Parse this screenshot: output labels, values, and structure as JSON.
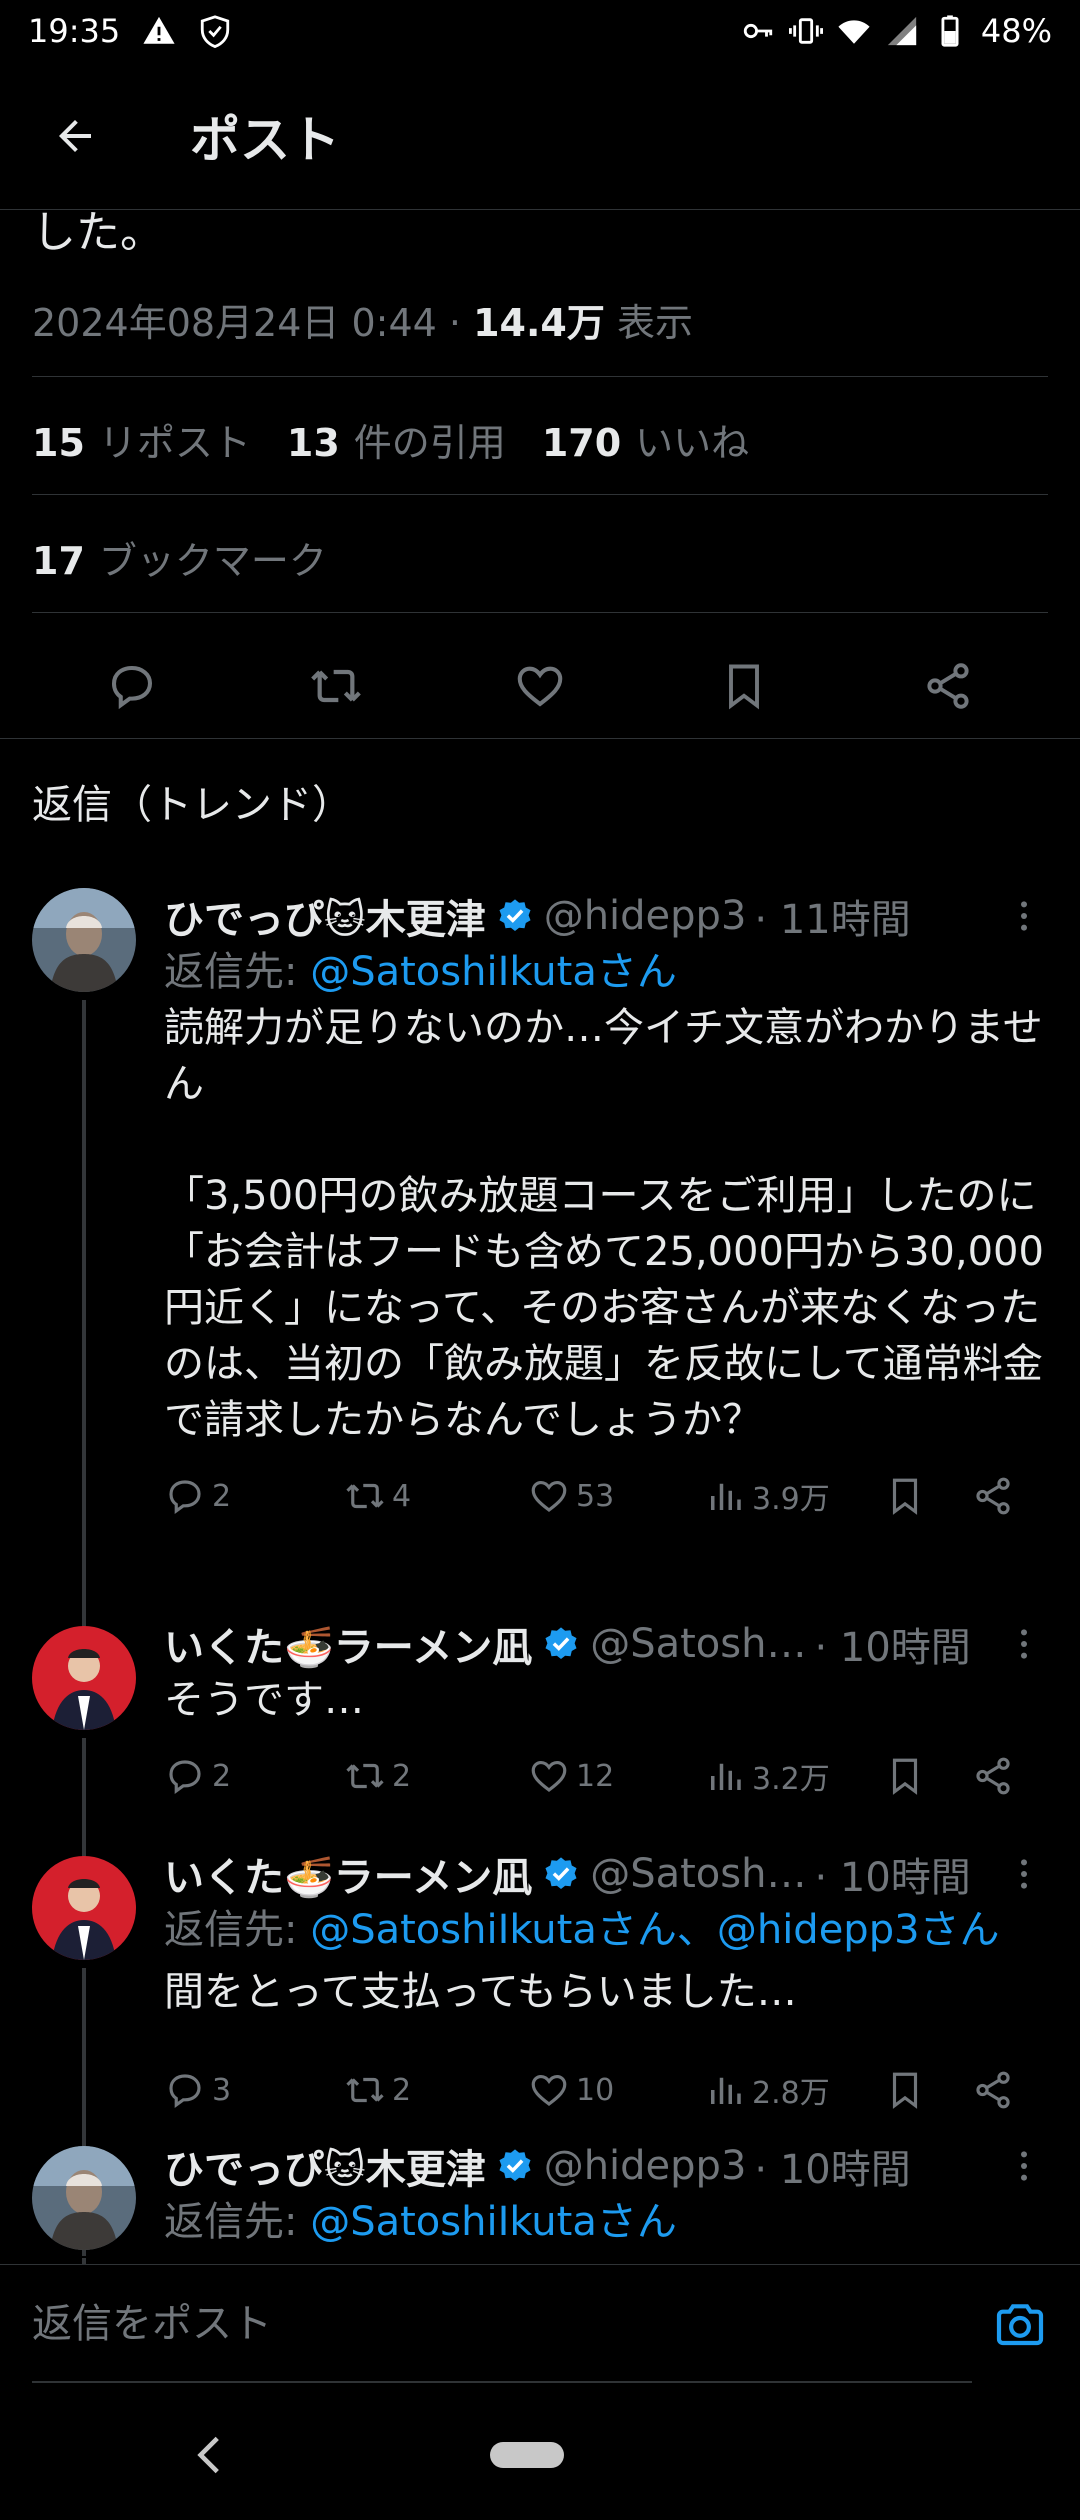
{
  "status_bar": {
    "time": "19:35",
    "battery": "48%",
    "icons_left": [
      "warning-icon",
      "shield-icon"
    ],
    "icons_right": [
      "key-icon",
      "vibrate-icon",
      "wifi-icon",
      "signal-icon",
      "battery-icon"
    ]
  },
  "header": {
    "title": "ポスト"
  },
  "post_detail": {
    "tail_text": "した。",
    "date": "2024年08月24日 0:44",
    "separator": "·",
    "views_value": "14.4万",
    "views_label": "表示",
    "reposts_value": "15",
    "reposts_label": "リポスト",
    "quotes_value": "13",
    "quotes_label": "件の引用",
    "likes_value": "170",
    "likes_label": "いいね",
    "bookmarks_value": "17",
    "bookmarks_label": "ブックマーク"
  },
  "section_label": "返信（トレンド）",
  "replies": [
    {
      "name": "ひでっぴ🐱木更津",
      "handle": "@hidepp3",
      "time": "· 11時間",
      "reply_to_label": "返信先: ",
      "reply_to": "@SatoshiIkutaさん",
      "text": "読解力が足りないのか…今イチ文意がわかりません\n\n「3,500円の飲み放題コースをご利用」したのに\n「お会計はフードも含めて25,000円から30,000円近く」になって、そのお客さんが来なくなったのは、当初の「飲み放題」を反故にして通常料金で請求したからなんでしょうか？",
      "replies": "2",
      "reposts": "4",
      "likes": "53",
      "views": "3.9万"
    },
    {
      "name": "いくた🍜ラーメン凪",
      "handle": "@Satosh…",
      "time": "· 10時間",
      "text": "そうです…",
      "replies": "2",
      "reposts": "2",
      "likes": "12",
      "views": "3.2万"
    },
    {
      "name": "いくた🍜ラーメン凪",
      "handle": "@Satosh…",
      "time": "· 10時間",
      "reply_to_label": "返信先: ",
      "reply_to": "@SatoshiIkutaさん、@hidepp3さん",
      "text": "間をとって支払ってもらいました…",
      "replies": "3",
      "reposts": "2",
      "likes": "10",
      "views": "2.8万"
    },
    {
      "name": "ひでっぴ🐱木更津",
      "handle": "@hidepp3",
      "time": "· 10時間",
      "reply_to_label": "返信先: ",
      "reply_to": "@SatoshiIkutaさん"
    }
  ],
  "compose": {
    "placeholder": "返信をポスト"
  },
  "colors": {
    "background": "#000000",
    "text": "#e7e9ea",
    "muted": "#71767b",
    "accent": "#1d9bf0",
    "divider": "#2f3336"
  }
}
